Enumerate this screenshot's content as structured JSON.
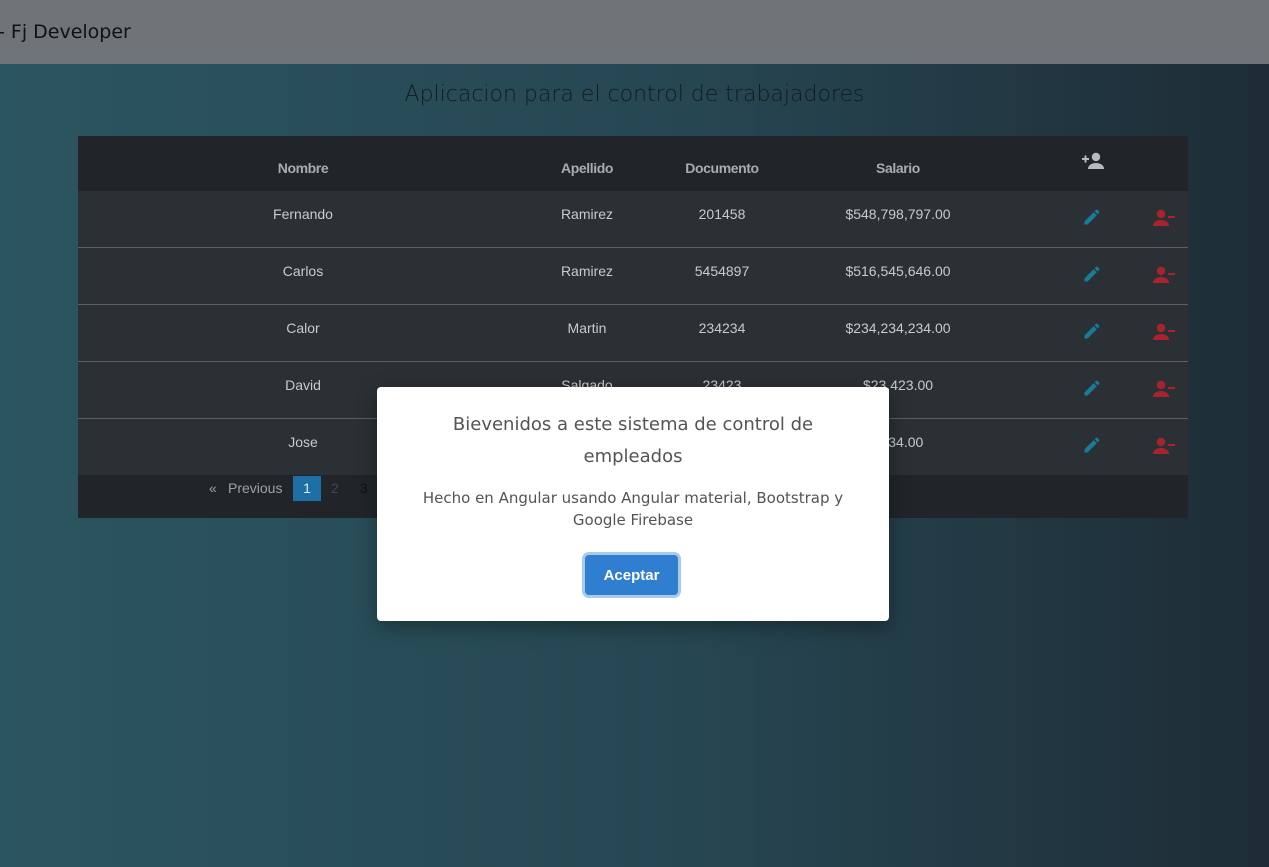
{
  "topbar": {
    "title": "- Fj Developer"
  },
  "page": {
    "title": "Aplicacion para el control de trabajadores"
  },
  "table": {
    "headers": {
      "nombre": "Nombre",
      "apellido": "Apellido",
      "documento": "Documento",
      "salario": "Salario"
    },
    "add_icon": "add-person-icon",
    "rows": [
      {
        "nombre": "Fernando",
        "apellido": "Ramirez",
        "documento": "201458",
        "salario": "$548,798,797.00"
      },
      {
        "nombre": "Carlos",
        "apellido": "Ramirez",
        "documento": "5454897",
        "salario": "$516,545,646.00"
      },
      {
        "nombre": "Calor",
        "apellido": "Martin",
        "documento": "234234",
        "salario": "$234,234,234.00"
      },
      {
        "nombre": "David",
        "apellido": "Salgado",
        "documento": "23423",
        "salario": "$23,423.00"
      },
      {
        "nombre": "Jose",
        "apellido": "",
        "documento": "",
        "salario": "$234.00"
      }
    ],
    "colors": {
      "edit": "#1a7a99",
      "delete": "#a8232e"
    }
  },
  "pagination": {
    "first": "«",
    "previous": "Previous",
    "pages": [
      "1",
      "2",
      "3"
    ],
    "current": "1"
  },
  "modal": {
    "title": "Bievenidos a este sistema de control de empleados",
    "text": "Hecho en Angular usando Angular material, Bootstrap y Google Firebase",
    "button": "Aceptar"
  }
}
